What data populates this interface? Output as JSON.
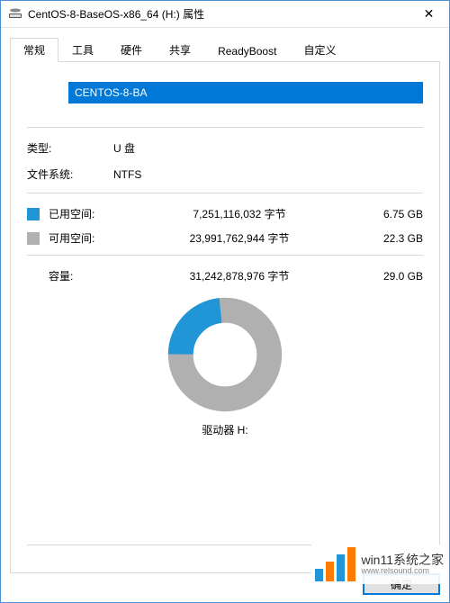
{
  "window": {
    "title": "CentOS-8-BaseOS-x86_64 (H:) 属性",
    "close_glyph": "✕"
  },
  "tabs": {
    "items": [
      {
        "label": "常规"
      },
      {
        "label": "工具"
      },
      {
        "label": "硬件"
      },
      {
        "label": "共享"
      },
      {
        "label": "ReadyBoost"
      },
      {
        "label": "自定义"
      }
    ],
    "active_index": 0
  },
  "general": {
    "volume_label": "CENTOS-8-BA",
    "type_label": "类型:",
    "type_value": "U 盘",
    "fs_label": "文件系统:",
    "fs_value": "NTFS",
    "used": {
      "label": "已用空间:",
      "bytes": "7,251,116,032 字节",
      "gb": "6.75 GB"
    },
    "free": {
      "label": "可用空间:",
      "bytes": "23,991,762,944 字节",
      "gb": "22.3 GB"
    },
    "capacity": {
      "label": "容量:",
      "bytes": "31,242,878,976 字节",
      "gb": "29.0 GB"
    },
    "drive_caption": "驱动器 H:"
  },
  "buttons": {
    "ok": "确定"
  },
  "colors": {
    "used": "#2196d6",
    "free": "#b0b0b0",
    "accent": "#0078d7"
  },
  "chart_data": {
    "type": "pie",
    "title": "驱动器 H:",
    "series": [
      {
        "name": "已用空间",
        "value": 7251116032,
        "color": "#2196d6"
      },
      {
        "name": "可用空间",
        "value": 23991762944,
        "color": "#b0b0b0"
      }
    ],
    "total": 31242878976
  },
  "watermark": {
    "cn": "win11系统之家",
    "en": "www.relsound.com"
  }
}
